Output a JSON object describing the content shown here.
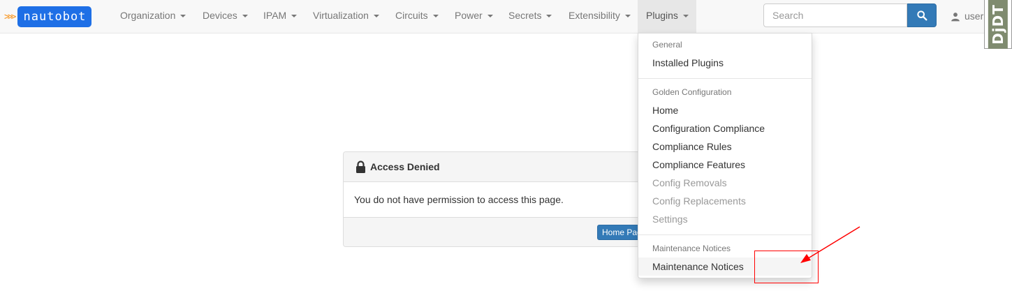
{
  "brand": {
    "chevrons": ">>>",
    "name": "nautobot"
  },
  "nav": {
    "items": [
      {
        "label": "Organization"
      },
      {
        "label": "Devices"
      },
      {
        "label": "IPAM"
      },
      {
        "label": "Virtualization"
      },
      {
        "label": "Circuits"
      },
      {
        "label": "Power"
      },
      {
        "label": "Secrets"
      },
      {
        "label": "Extensibility"
      },
      {
        "label": "Plugins"
      }
    ],
    "active": "Plugins"
  },
  "search": {
    "placeholder": "Search",
    "button_icon": "search-icon"
  },
  "user": {
    "label": "user",
    "icon": "user-icon"
  },
  "debug_toolbar": {
    "label": "DjDT"
  },
  "plugins_menu": {
    "general_header": "General",
    "installed_plugins": "Installed Plugins",
    "golden_header": "Golden Configuration",
    "golden_items": [
      "Home",
      "Configuration Compliance",
      "Compliance Rules",
      "Compliance Features",
      "Config Removals",
      "Config Replacements",
      "Settings"
    ],
    "maintenance_header": "Maintenance Notices",
    "maintenance_item": "Maintenance Notices"
  },
  "panel": {
    "title": "Access Denied",
    "icon": "lock-icon",
    "message": "You do not have permission to access this page.",
    "home_button": "Home Page"
  },
  "annotation": {
    "color": "#ff0000"
  }
}
